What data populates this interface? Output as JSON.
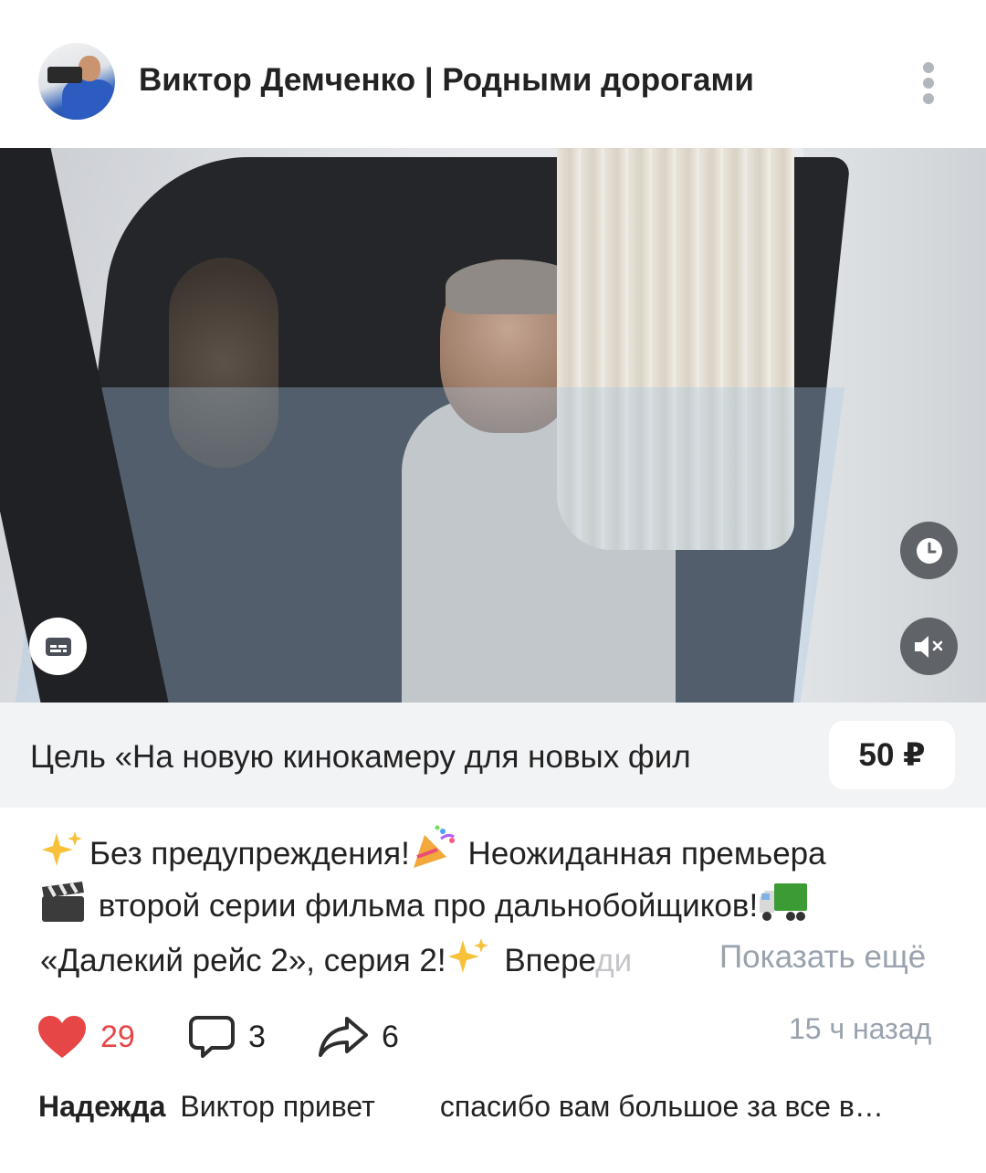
{
  "post": {
    "channel_name": "Виктор Демченко | Родными дорогами",
    "more_icon": "more-vertical-icon",
    "video": {
      "subtitles_icon": "subtitles-icon",
      "watch_later_icon": "clock-icon",
      "mute_icon": "volume-muted-icon"
    },
    "goal": {
      "text": "Цель «На новую кинокамеру для новых фил",
      "amount": "50 ₽"
    },
    "text_lines": {
      "line1_a": "Без предупреждения!",
      "line1_b": " Неожиданная премьера",
      "line2": " второй серии фильма про дальнобойщиков!",
      "line3_a": "«Далекий рейс 2», серия 2!",
      "line3_b": " Впере",
      "line3_fade": "ди"
    },
    "show_more": "Показать ещё",
    "emojis": [
      "sparkles",
      "party-popper",
      "clapper-board",
      "truck",
      "sparkles"
    ],
    "likes": "29",
    "comments": "3",
    "shares": "6",
    "timestamp": "15 ч назад",
    "like_color": "#e64646",
    "latest_comment": {
      "author": "Надежда",
      "text": "Виктор привет        спасибо вам большое за все в…"
    }
  }
}
